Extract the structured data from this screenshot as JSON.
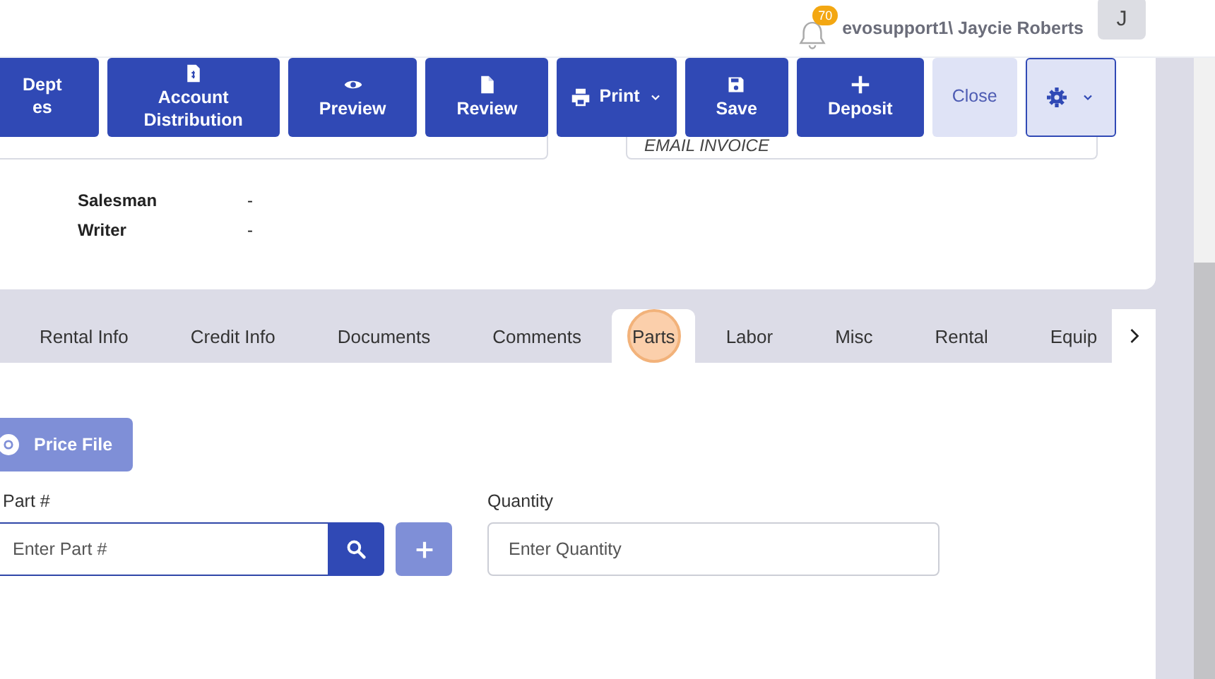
{
  "header": {
    "notification_count": "70",
    "user": "evosupport1\\ Jaycie Roberts",
    "avatar": "J"
  },
  "toolbar": [
    {
      "kind": "primary",
      "lines": [
        "Dept",
        "es"
      ]
    },
    {
      "kind": "primary",
      "lines": [
        "Account",
        "Distribution"
      ]
    },
    {
      "kind": "primary",
      "lines": [
        "Preview"
      ]
    },
    {
      "kind": "primary",
      "lines": [
        "Review"
      ]
    },
    {
      "kind": "dropdown",
      "lines": [
        "Print"
      ]
    },
    {
      "kind": "primary",
      "lines": [
        "Save"
      ]
    },
    {
      "kind": "primary",
      "lines": [
        "Deposit"
      ]
    },
    {
      "kind": "light",
      "lines": [
        "Close"
      ]
    },
    {
      "kind": "settings"
    }
  ],
  "info_fields": [
    {
      "kind": "empty"
    },
    {
      "kind": "text",
      "value": "EMAIL INVOICE"
    }
  ],
  "details": [
    {
      "label": "Salesman",
      "value": "-"
    },
    {
      "label": "Writer",
      "value": "-"
    }
  ],
  "tabs": [
    {
      "label": "Rental Info",
      "selected": false,
      "highlighted": false
    },
    {
      "label": "Credit Info",
      "selected": false,
      "highlighted": false
    },
    {
      "label": "Documents",
      "selected": false,
      "highlighted": false
    },
    {
      "label": "Comments",
      "selected": false,
      "highlighted": false
    },
    {
      "label": "Parts",
      "selected": true,
      "highlighted": true
    },
    {
      "label": "Labor",
      "selected": false,
      "highlighted": false
    },
    {
      "label": "Misc",
      "selected": false,
      "highlighted": false
    },
    {
      "label": "Rental",
      "selected": false,
      "highlighted": false
    },
    {
      "label": "Equip",
      "selected": false,
      "highlighted": false
    }
  ],
  "parts_form": {
    "price_file_button": "Price File",
    "part_field": {
      "label": "Part #",
      "placeholder": "Enter Part #"
    },
    "quantity_field": {
      "label": "Quantity",
      "placeholder": "Enter Quantity"
    }
  }
}
